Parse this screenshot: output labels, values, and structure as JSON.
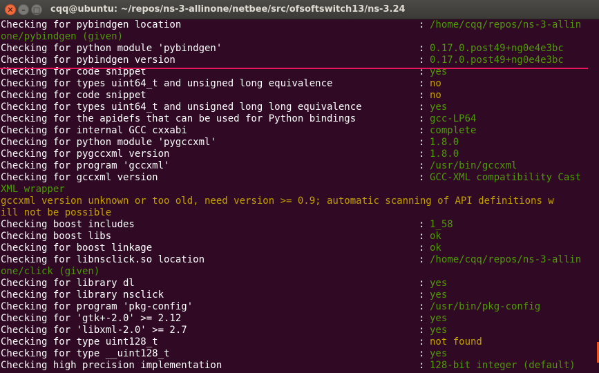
{
  "window": {
    "title": "cqq@ubuntu: ~/repos/ns-3-allinone/netbee/src/ofsoftswitch13/ns-3.24",
    "close_glyph": "✕",
    "minimize_glyph": "–",
    "maximize_glyph": "□"
  },
  "colors": {
    "background": "#300a24",
    "label": "#ffffff",
    "green": "#4e9a06",
    "yellow": "#c4a000",
    "annotation": "#e8175d"
  },
  "lines": [
    {
      "label": "Checking for pybindgen location",
      "value": "/home/cqq/repos/ns-3-allin",
      "color": "green"
    },
    {
      "kind": "cont",
      "text": "one/pybindgen (given)",
      "color": "green"
    },
    {
      "label": "Checking for python module 'pybindgen'",
      "value": "0.17.0.post49+ng0e4e3bc",
      "color": "green"
    },
    {
      "label": "Checking for pybindgen version",
      "value": "0.17.0.post49+ng0e4e3bc",
      "color": "green"
    },
    {
      "label": "Checking for code snippet",
      "value": "yes",
      "color": "green"
    },
    {
      "label": "Checking for types uint64_t and unsigned long equivalence",
      "value": "no",
      "color": "yellow"
    },
    {
      "label": "Checking for code snippet",
      "value": "no",
      "color": "yellow"
    },
    {
      "label": "Checking for types uint64_t and unsigned long long equivalence",
      "value": "yes",
      "color": "green"
    },
    {
      "label": "Checking for the apidefs that can be used for Python bindings",
      "value": "gcc-LP64",
      "color": "green"
    },
    {
      "label": "Checking for internal GCC cxxabi",
      "value": "complete",
      "color": "green"
    },
    {
      "label": "Checking for python module 'pygccxml'",
      "value": "1.8.0",
      "color": "green"
    },
    {
      "label": "Checking for pygccxml version",
      "value": "1.8.0",
      "color": "green"
    },
    {
      "label": "Checking for program 'gccxml'",
      "value": "/usr/bin/gccxml",
      "color": "green"
    },
    {
      "label": "Checking for gccxml version",
      "value": "GCC-XML compatibility Cast",
      "color": "green"
    },
    {
      "kind": "cont",
      "text": "XML wrapper",
      "color": "green"
    },
    {
      "kind": "full",
      "text": "gccxml version unknown or too old, need version >= 0.9; automatic scanning of API definitions w",
      "color": "yellow"
    },
    {
      "kind": "full",
      "text": "ill not be possible",
      "color": "yellow"
    },
    {
      "label": "Checking boost includes",
      "value": "1_58",
      "color": "green"
    },
    {
      "label": "Checking boost libs",
      "value": "ok",
      "color": "green"
    },
    {
      "label": "Checking for boost linkage",
      "value": "ok",
      "color": "green"
    },
    {
      "label": "Checking for libnsclick.so location",
      "value": "/home/cqq/repos/ns-3-allin",
      "color": "green"
    },
    {
      "kind": "cont",
      "text": "one/click (given)",
      "color": "green"
    },
    {
      "label": "Checking for library dl",
      "value": "yes",
      "color": "green"
    },
    {
      "label": "Checking for library nsclick",
      "value": "yes",
      "color": "green"
    },
    {
      "label": "Checking for program 'pkg-config'",
      "value": "/usr/bin/pkg-config",
      "color": "green"
    },
    {
      "label": "Checking for 'gtk+-2.0' >= 2.12",
      "value": "yes",
      "color": "green"
    },
    {
      "label": "Checking for 'libxml-2.0' >= 2.7",
      "value": "yes",
      "color": "green"
    },
    {
      "label": "Checking for type uint128_t",
      "value": "not found",
      "color": "yellow"
    },
    {
      "label": "Checking for type __uint128_t",
      "value": "yes",
      "color": "green"
    },
    {
      "label": "Checking high precision implementation",
      "value": "128-bit integer (default)",
      "color": "green"
    }
  ],
  "separator": ":"
}
